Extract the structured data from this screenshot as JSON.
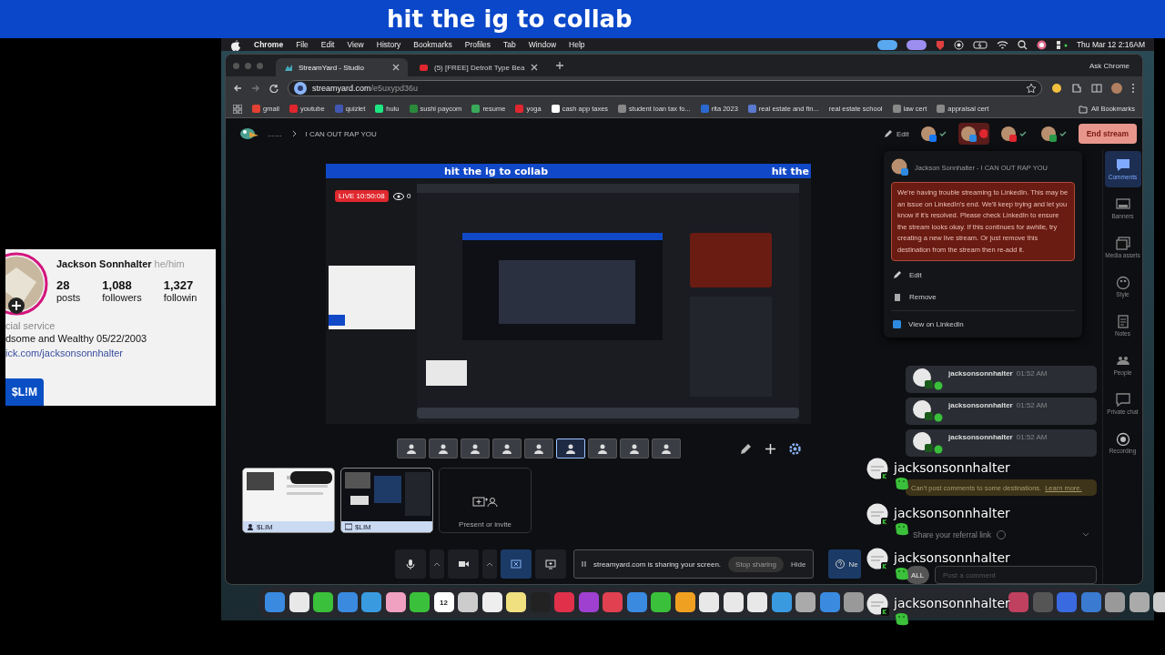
{
  "banner": {
    "text": "hit the ig to collab"
  },
  "profile": {
    "name": "Jackson Sonnhalter",
    "pronouns": "he/him",
    "stats": [
      {
        "value": "28",
        "label": "posts"
      },
      {
        "value": "1,088",
        "label": "followers"
      },
      {
        "value": "1,327",
        "label": "followin"
      }
    ],
    "category": "cial service",
    "bio": "dsome and Wealthy 05/22/2003",
    "link": "ick.com/jacksonsonnhalter",
    "tag": "$L!M"
  },
  "menu_bar": {
    "app": "Chrome",
    "items": [
      "File",
      "Edit",
      "View",
      "History",
      "Bookmarks",
      "Profiles",
      "Tab",
      "Window",
      "Help"
    ],
    "clock": "Thu Mar 12  2:16AM"
  },
  "browser": {
    "tabs": [
      {
        "label": "StreamYard - Studio",
        "selected": true
      },
      {
        "label": "(5) [FREE] Detroit Type Bea",
        "selected": false
      }
    ],
    "ask": "Ask Chrome",
    "url_host": "streamyard.com",
    "url_path": "/e5uxypd36u",
    "bookmarks": [
      "gmail",
      "youtube",
      "quizlet",
      "hulu",
      "sushi paycom",
      "resume",
      "yoga",
      "cash app taxes",
      "student loan tax fo...",
      "rita 2023",
      "real estate and fin...",
      "real estate school",
      "law cert",
      "appraisal cert"
    ],
    "all_bookmarks": "All Bookmarks"
  },
  "studio": {
    "breadcrumb_dots": ".......",
    "breadcrumb_title": "I CAN OUT RAP YOU",
    "edit": "Edit",
    "end_stream": "End stream",
    "destinations": [
      {
        "kind": "facebook",
        "error": false
      },
      {
        "kind": "linkedin",
        "error": true
      },
      {
        "kind": "youtube",
        "error": false
      },
      {
        "kind": "other",
        "error": false
      }
    ],
    "preview": {
      "banner": "hit the ig to collab",
      "banner_right": "hit the",
      "live": "LIVE 10:50:08",
      "viewers": "0"
    },
    "layouts": [
      {
        "selected": false
      },
      {
        "selected": false
      },
      {
        "selected": false
      },
      {
        "selected": false
      },
      {
        "selected": false
      },
      {
        "selected": true
      },
      {
        "selected": false
      },
      {
        "selected": false
      },
      {
        "selected": false
      }
    ],
    "sources": [
      {
        "kind": "camera",
        "label": "$LIM"
      },
      {
        "kind": "screen",
        "label": "$LIM"
      }
    ],
    "present": "Present or invite",
    "share_bar": {
      "text": "streamyard.com is sharing your screen.",
      "stop": "Stop sharing",
      "hide": "Hide"
    },
    "help": "Ne"
  },
  "popup": {
    "title": "Jackson Sonnhalter - I CAN OUT RAP YOU",
    "error": "We're having trouble streaming to LinkedIn. This may be an issue on LinkedIn's end. We'll keep trying and let you know if it's resolved. Please check LinkedIn to ensure the stream looks okay. If this continues for awhile, try creating a new live stream. Or just remove this destination from the stream then re-add it.",
    "actions": [
      "Edit",
      "Remove"
    ],
    "view": "View on LinkedIn"
  },
  "comments": {
    "items": [
      {
        "user": "jacksonsonnhalter",
        "time": "01:52 AM"
      },
      {
        "user": "jacksonsonnhalter",
        "time": "01:52 AM"
      },
      {
        "user": "jacksonsonnhalter",
        "time": "01:52 AM"
      }
    ],
    "notice": "Can't post comments to some destinations.",
    "learn": "Learn more.",
    "referral": "Share your referral link",
    "filter": "ALL",
    "placeholder": "Post a comment"
  },
  "rail": [
    {
      "label": "Comments",
      "selected": true
    },
    {
      "label": "Banners",
      "selected": false
    },
    {
      "label": "Media assets",
      "selected": false
    },
    {
      "label": "Style",
      "selected": false
    },
    {
      "label": "Notes",
      "selected": false
    },
    {
      "label": "People",
      "selected": false
    },
    {
      "label": "Private chat",
      "selected": false
    },
    {
      "label": "Recording",
      "selected": false
    }
  ],
  "dock": {
    "calendar_day": "12"
  },
  "chat_overlay": [
    {
      "user": "jacksonsonnhalter"
    },
    {
      "user": "jacksonsonnhalter"
    },
    {
      "user": "jacksonsonnhalter"
    },
    {
      "user": "jacksonsonnhalter"
    }
  ]
}
